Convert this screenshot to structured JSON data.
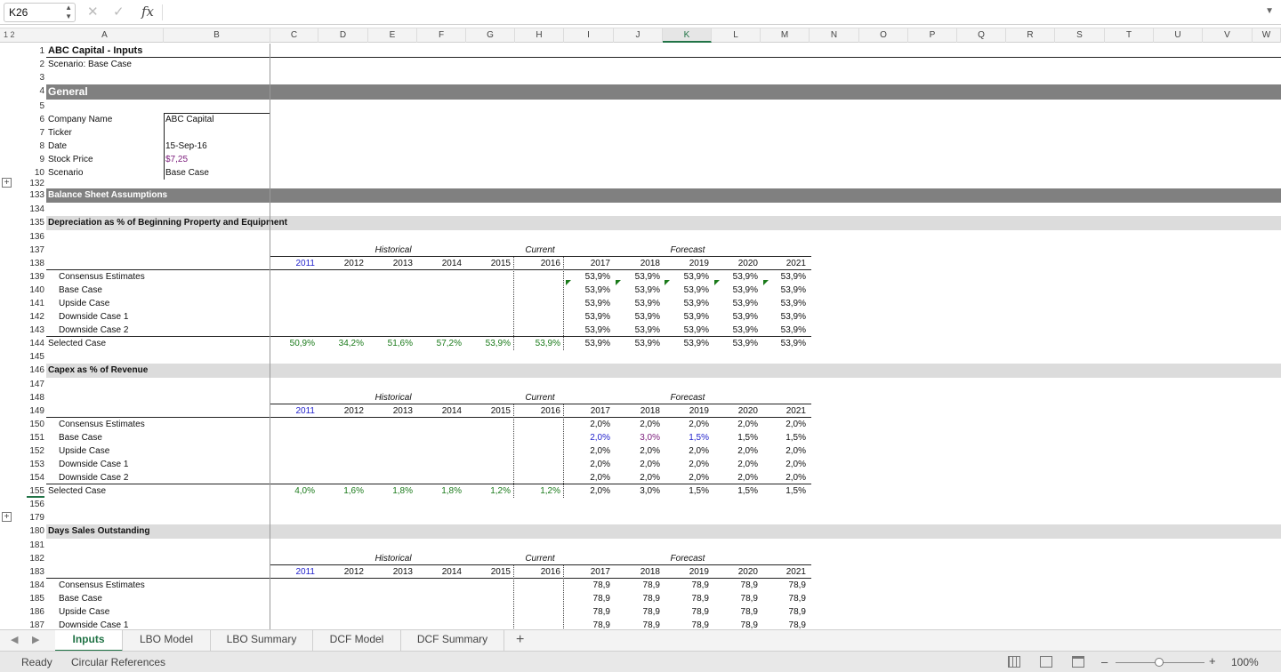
{
  "formula_bar": {
    "name_box": "K26",
    "cancel_icon": "✕",
    "enter_icon": "✓",
    "fx": "fx",
    "formula": ""
  },
  "outline_levels": "1 2",
  "columns": [
    "A",
    "B",
    "C",
    "D",
    "E",
    "F",
    "G",
    "H",
    "I",
    "J",
    "K",
    "L",
    "M",
    "N",
    "O",
    "P",
    "Q",
    "R",
    "S",
    "T",
    "U",
    "V",
    "W"
  ],
  "selected_column": "K",
  "header": {
    "title": "ABC Capital - Inputs",
    "scenario": "Scenario: Base Case",
    "general": "General"
  },
  "general_fields": [
    {
      "label": "Company Name",
      "value": "ABC Capital"
    },
    {
      "label": "Ticker",
      "value": ""
    },
    {
      "label": "Date",
      "value": "15-Sep-16"
    },
    {
      "label": "Stock Price",
      "value": "$7,25"
    },
    {
      "label": "Scenario",
      "value": "Base Case"
    }
  ],
  "section_title": "Balance Sheet Assumptions",
  "period_labels": {
    "historical": "Historical",
    "current": "Current",
    "forecast": "Forecast"
  },
  "years": [
    "2011",
    "2012",
    "2013",
    "2014",
    "2015",
    "2016",
    "2017",
    "2018",
    "2019",
    "2020",
    "2021"
  ],
  "blocks": [
    {
      "title": "Depreciation as % of Beginning Property and Equipment",
      "cases": [
        {
          "label": "Consensus Estimates",
          "values": [
            "53,9%",
            "53,9%",
            "53,9%",
            "53,9%",
            "53,9%"
          ]
        },
        {
          "label": "Base Case",
          "values": [
            "53,9%",
            "53,9%",
            "53,9%",
            "53,9%",
            "53,9%"
          ]
        },
        {
          "label": "Upside Case",
          "values": [
            "53,9%",
            "53,9%",
            "53,9%",
            "53,9%",
            "53,9%"
          ]
        },
        {
          "label": "Downside Case 1",
          "values": [
            "53,9%",
            "53,9%",
            "53,9%",
            "53,9%",
            "53,9%"
          ]
        },
        {
          "label": "Downside Case 2",
          "values": [
            "53,9%",
            "53,9%",
            "53,9%",
            "53,9%",
            "53,9%"
          ]
        }
      ],
      "selected": {
        "label": "Selected Case",
        "historical": [
          "50,9%",
          "34,2%",
          "51,6%",
          "57,2%",
          "53,9%"
        ],
        "current": "53,9%",
        "forecast": [
          "53,9%",
          "53,9%",
          "53,9%",
          "53,9%",
          "53,9%"
        ]
      }
    },
    {
      "title": "Capex as % of Revenue",
      "cases": [
        {
          "label": "Consensus Estimates",
          "values": [
            "2,0%",
            "2,0%",
            "2,0%",
            "2,0%",
            "2,0%"
          ]
        },
        {
          "label": "Base Case",
          "values": [
            "2,0%",
            "3,0%",
            "1,5%",
            "1,5%",
            "1,5%"
          ]
        },
        {
          "label": "Upside Case",
          "values": [
            "2,0%",
            "2,0%",
            "2,0%",
            "2,0%",
            "2,0%"
          ]
        },
        {
          "label": "Downside Case 1",
          "values": [
            "2,0%",
            "2,0%",
            "2,0%",
            "2,0%",
            "2,0%"
          ]
        },
        {
          "label": "Downside Case 2",
          "values": [
            "2,0%",
            "2,0%",
            "2,0%",
            "2,0%",
            "2,0%"
          ]
        }
      ],
      "selected": {
        "label": "Selected Case",
        "historical": [
          "4,0%",
          "1,6%",
          "1,8%",
          "1,8%",
          "1,2%"
        ],
        "current": "1,2%",
        "forecast": [
          "2,0%",
          "3,0%",
          "1,5%",
          "1,5%",
          "1,5%"
        ]
      }
    },
    {
      "title": "Days Sales Outstanding",
      "cases": [
        {
          "label": "Consensus Estimates",
          "values": [
            "78,9",
            "78,9",
            "78,9",
            "78,9",
            "78,9"
          ]
        },
        {
          "label": "Base Case",
          "values": [
            "78,9",
            "78,9",
            "78,9",
            "78,9",
            "78,9"
          ]
        },
        {
          "label": "Upside Case",
          "values": [
            "78,9",
            "78,9",
            "78,9",
            "78,9",
            "78,9"
          ]
        },
        {
          "label": "Downside Case 1",
          "values": [
            "78,9",
            "78,9",
            "78,9",
            "78,9",
            "78,9"
          ]
        }
      ]
    }
  ],
  "row_numbers": {
    "title": "1",
    "scenario": "2",
    "blank3": "3",
    "general": "4",
    "blank5": "5",
    "fields": [
      "6",
      "7",
      "8",
      "9",
      "10"
    ],
    "r132": "132",
    "section": "133",
    "r134": "134",
    "b1": [
      "135",
      "136",
      "137",
      "138",
      "139",
      "140",
      "141",
      "142",
      "143",
      "144",
      "145"
    ],
    "b2": [
      "146",
      "147",
      "148",
      "149",
      "150",
      "151",
      "152",
      "153",
      "154",
      "155",
      "156"
    ],
    "r179": "179",
    "b3": [
      "180",
      "181",
      "182",
      "183",
      "184",
      "185",
      "186",
      "187"
    ]
  },
  "sheet_tabs": [
    "Inputs",
    "LBO Model",
    "LBO Summary",
    "DCF Model",
    "DCF Summary"
  ],
  "active_tab": "Inputs",
  "status": {
    "ready": "Ready",
    "circular": "Circular References",
    "zoom": "100%"
  },
  "colors": {
    "accent": "#217346",
    "green_value": "#1a7a1a",
    "blue_input": "#2222cc",
    "purple_input": "#7a1a7a",
    "section_band": "#808080",
    "sub_band": "#dcdcdc"
  }
}
